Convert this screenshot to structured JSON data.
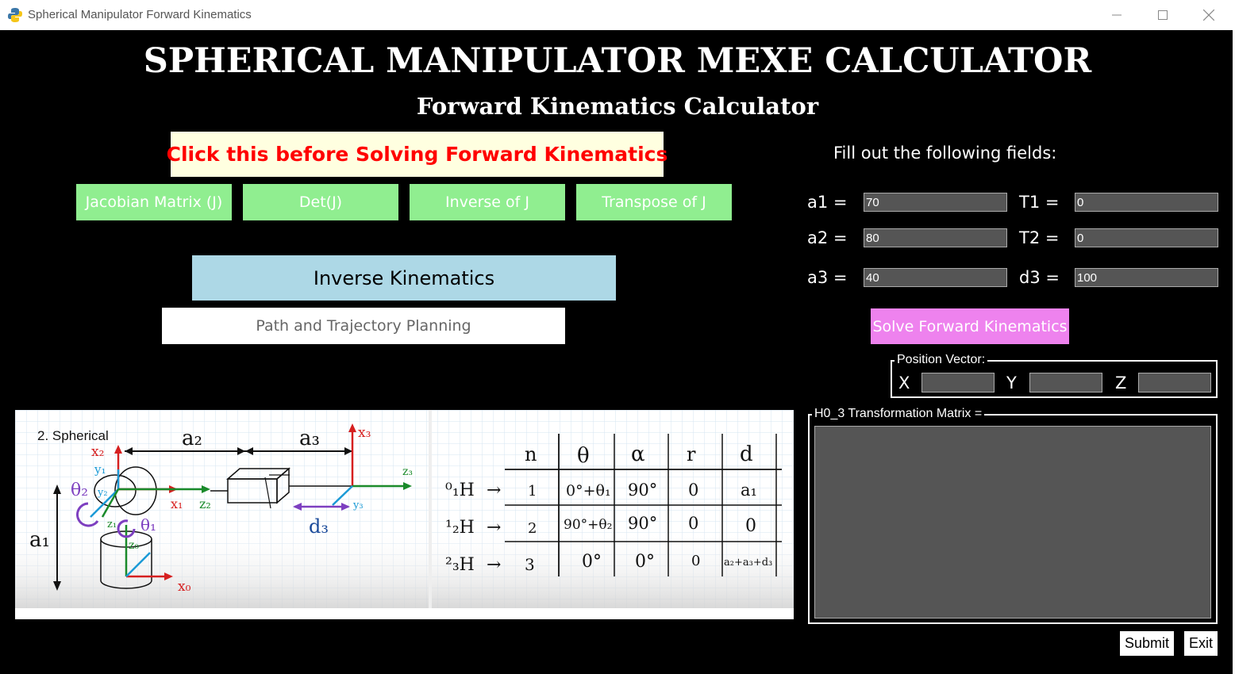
{
  "window": {
    "title": "Spherical Manipulator Forward Kinematics",
    "minimize_icon": "minimize-icon",
    "maximize_icon": "maximize-icon",
    "close_icon": "close-icon"
  },
  "header": {
    "title": "SPHERICAL MANIPULATOR MEXE CALCULATOR",
    "subtitle": "Forward Kinematics Calculator"
  },
  "left_panel": {
    "warning_button": "Click this before Solving Forward Kinematics",
    "jacobian_buttons": [
      "Jacobian Matrix (J)",
      "Det(J)",
      "Inverse of J",
      "Transpose of J"
    ],
    "inverse_kinematics_button": "Inverse Kinematics",
    "path_button": "Path and Trajectory Planning"
  },
  "form": {
    "instruction": "Fill out the following fields:",
    "fields": [
      {
        "label": "a1 =",
        "value": "70"
      },
      {
        "label": "T1 =",
        "value": "0"
      },
      {
        "label": "a2 =",
        "value": "80"
      },
      {
        "label": "T2 =",
        "value": "0"
      },
      {
        "label": "a3 =",
        "value": "40"
      },
      {
        "label": "d3 =",
        "value": "100"
      }
    ],
    "solve_button": "Solve Forward Kinematics"
  },
  "position_vector": {
    "title": "Position Vector:",
    "axes": [
      "X",
      "Y",
      "Z"
    ],
    "values": [
      "",
      "",
      ""
    ]
  },
  "matrix": {
    "title": "H0_3 Transformation Matrix ="
  },
  "footer": {
    "submit": "Submit",
    "exit": "Exit"
  },
  "diagram": {
    "caption": "2.  Spherical",
    "labels": [
      "a₂",
      "a₃",
      "a₁",
      "d₃",
      "x₃",
      "z₃",
      "x₂",
      "y₁",
      "y₂",
      "θ₂",
      "z₁",
      "z₂",
      "x₁",
      "θ₁",
      "z₀",
      "x₀",
      "y₃"
    ],
    "table_headers": [
      "n",
      "θ",
      "α",
      "r",
      "d"
    ],
    "table_rows": [
      {
        "h": "⁰₁H",
        "n": "1",
        "theta": "0°+θ₁",
        "alpha": "90°",
        "r": "0",
        "d": "a₁"
      },
      {
        "h": "¹₂H",
        "n": "2",
        "theta": "90°+θ₂",
        "alpha": "90°",
        "r": "0",
        "d": "0"
      },
      {
        "h": "²₃H",
        "n": "3",
        "theta": "0°",
        "alpha": "0°",
        "r": "0",
        "d": "a₂+a₃+d₃"
      }
    ]
  }
}
